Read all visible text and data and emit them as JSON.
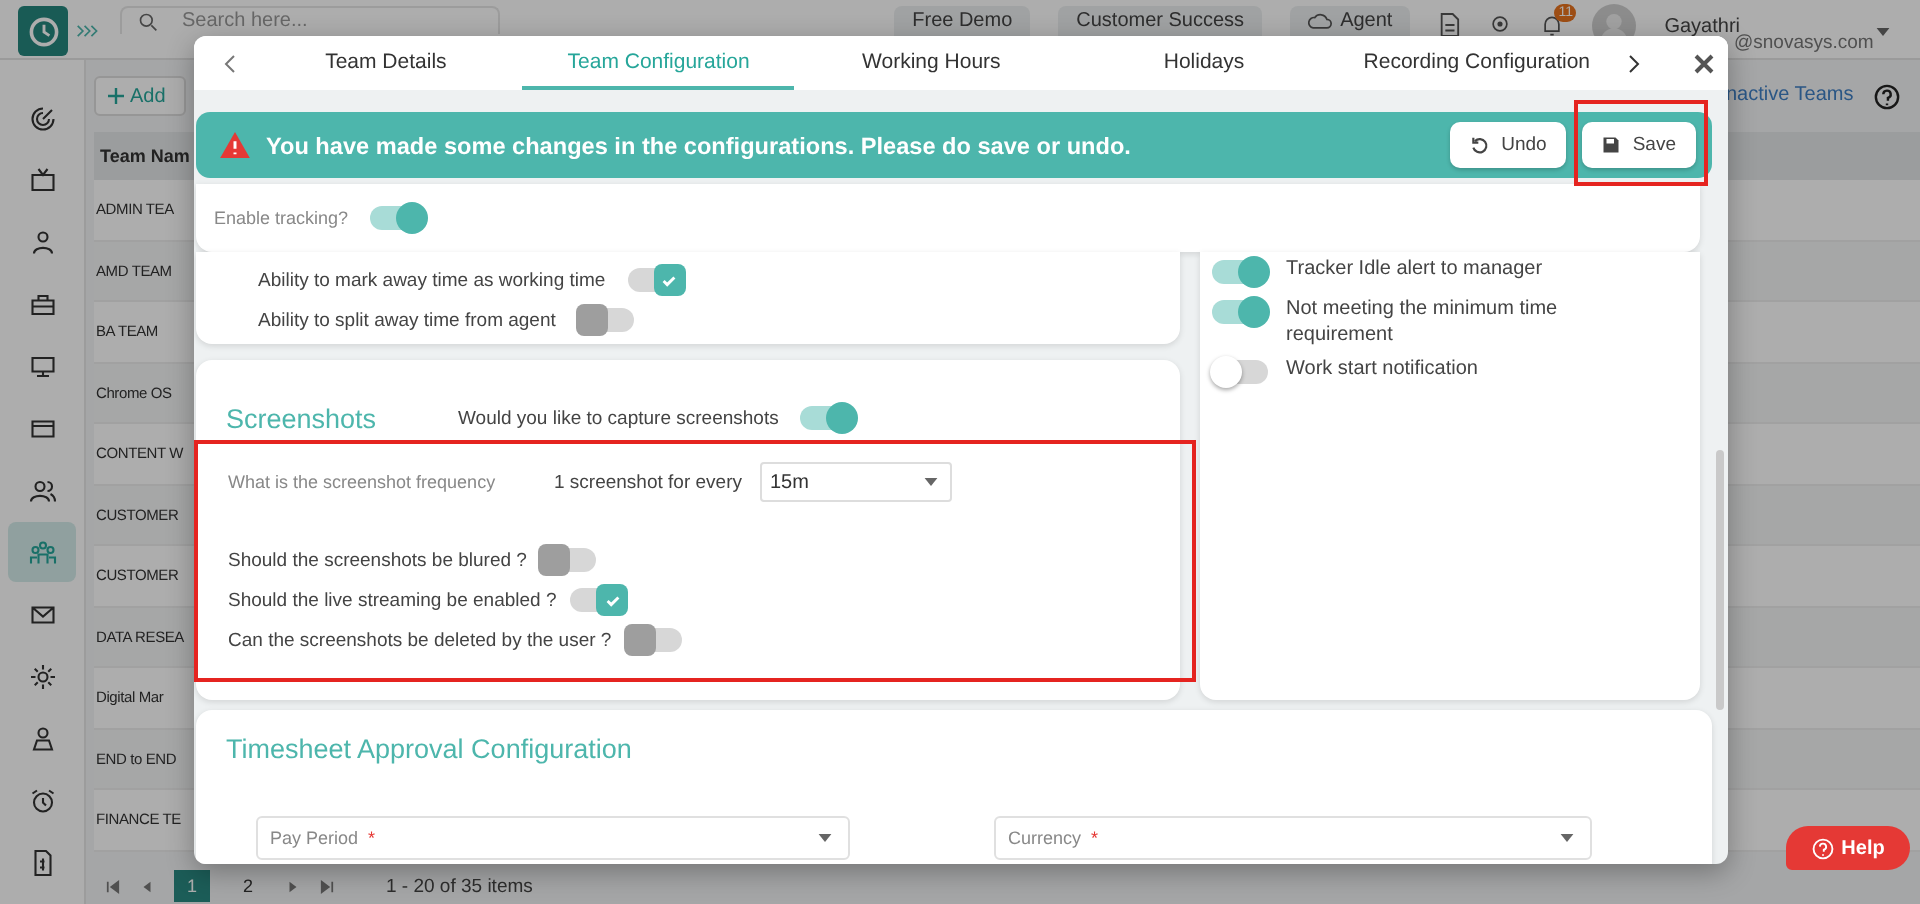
{
  "sidebar": {
    "items": [
      {
        "selected": false
      },
      {
        "selected": false
      },
      {
        "selected": false
      },
      {
        "selected": false
      },
      {
        "selected": false
      },
      {
        "selected": false
      },
      {
        "selected": false
      },
      {
        "selected": true
      },
      {
        "selected": false
      },
      {
        "selected": false
      },
      {
        "selected": false
      },
      {
        "selected": false
      },
      {
        "selected": false
      }
    ]
  },
  "topbar": {
    "search": {
      "placeholder": "Search here..."
    },
    "buttons": [
      "Free Demo",
      "Customer Success"
    ],
    "agent_button": "Agent",
    "notification_badge": "11",
    "user": {
      "name": "Gayathri",
      "email": "@snovasys.com"
    }
  },
  "page": {
    "add_button": "Add",
    "inactive_link": "nactive Teams",
    "table": {
      "columns": [
        "Team Nam"
      ],
      "rows": [
        "ADMIN TEA",
        "AMD TEAM",
        "BA TEAM",
        "Chrome OS",
        "CONTENT W",
        "CUSTOMER",
        "CUSTOMER",
        "DATA RESEA",
        "Digital Mar",
        "END to END",
        "FINANCE TE"
      ]
    },
    "pagination": {
      "pages": [
        {
          "label": "1",
          "selected": true
        },
        {
          "label": "2",
          "selected": false
        }
      ],
      "summary": "1 - 20 of 35 items"
    }
  },
  "dialog": {
    "tabs": [
      {
        "label": "Team Details",
        "selected": false
      },
      {
        "label": "Team Configuration",
        "selected": true
      },
      {
        "label": "Working Hours",
        "selected": false
      },
      {
        "label": "Holidays",
        "selected": false
      },
      {
        "label": "Recording Configuration",
        "selected": false
      }
    ],
    "banner": {
      "message": "You have made some changes in the configurations. Please do save or undo.",
      "undo": "Undo",
      "save": "Save"
    },
    "enable_tracking": {
      "label": "Enable tracking?",
      "on": true,
      "kind": "switch"
    },
    "away_options": [
      {
        "label": "Ability to mark away time as working time",
        "on": true,
        "kind": "check"
      },
      {
        "label": "Ability to split away time from agent",
        "on": false,
        "kind": "check"
      }
    ],
    "alerts": [
      {
        "label": "Tracker Idle alert to manager",
        "on": true,
        "kind": "switch"
      },
      {
        "label": "Not meeting the minimum time requirement",
        "on": true,
        "kind": "switch"
      },
      {
        "label": "Work start notification",
        "on": false,
        "kind": "switch"
      }
    ],
    "screenshots": {
      "title": "Screenshots",
      "capture": {
        "label": "Would you like to capture screenshots",
        "on": true,
        "kind": "switch"
      },
      "frequency": {
        "label": "What is the screenshot frequency",
        "prefix": "1 screenshot for every",
        "value": "15m"
      },
      "options": [
        {
          "label": "Should the screenshots be blured ?",
          "on": false,
          "kind": "check"
        },
        {
          "label": "Should the live streaming be enabled ?",
          "on": true,
          "kind": "check"
        },
        {
          "label": "Can the screenshots be deleted by the user ?",
          "on": false,
          "kind": "check"
        }
      ]
    },
    "timesheet": {
      "title": "Timesheet Approval Configuration",
      "fields": [
        {
          "label": "Pay Period",
          "required_mark": "*"
        },
        {
          "label": "Currency",
          "required_mark": "*"
        }
      ]
    }
  },
  "help_button": "Help"
}
